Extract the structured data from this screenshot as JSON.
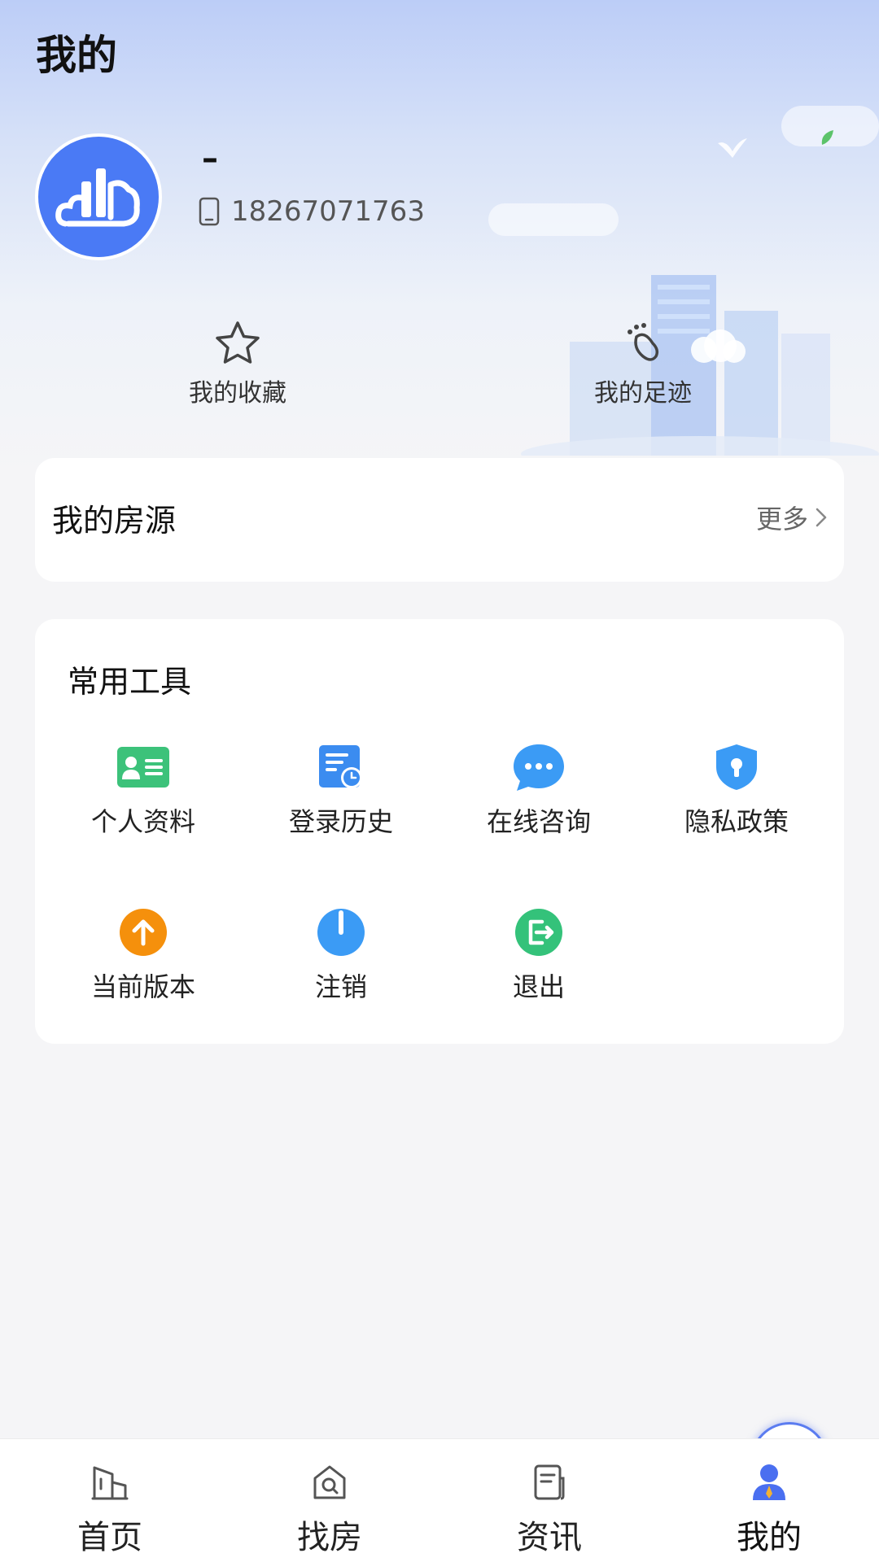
{
  "header": {
    "title": "我的"
  },
  "profile": {
    "name": "–",
    "phone": "18267071763"
  },
  "quick_actions": [
    {
      "label": "我的收藏",
      "icon": "star-icon"
    },
    {
      "label": "我的足迹",
      "icon": "footprint-icon"
    }
  ],
  "listings": {
    "title": "我的房源",
    "more_label": "更多"
  },
  "tools": {
    "title": "常用工具",
    "items": [
      {
        "label": "个人资料",
        "icon": "id-card-icon",
        "color": "#3cc27a"
      },
      {
        "label": "登录历史",
        "icon": "history-icon",
        "color": "#3b8cf0"
      },
      {
        "label": "在线咨询",
        "icon": "chat-icon",
        "color": "#3b9bf5"
      },
      {
        "label": "隐私政策",
        "icon": "shield-icon",
        "color": "#3b9bf5"
      },
      {
        "label": "当前版本",
        "icon": "upload-icon",
        "color": "#f5900c"
      },
      {
        "label": "注销",
        "icon": "power-icon",
        "color": "#3b9bf5"
      },
      {
        "label": "退出",
        "icon": "logout-icon",
        "color": "#34c27a"
      }
    ]
  },
  "tabbar": {
    "items": [
      {
        "label": "首页",
        "icon": "home-building-icon",
        "active": false
      },
      {
        "label": "找房",
        "icon": "find-house-icon",
        "active": false
      },
      {
        "label": "资讯",
        "icon": "news-icon",
        "active": false
      },
      {
        "label": "我的",
        "icon": "user-icon",
        "active": true
      }
    ]
  },
  "colors": {
    "accent": "#4a7af5",
    "background": "#f5f5f7"
  }
}
